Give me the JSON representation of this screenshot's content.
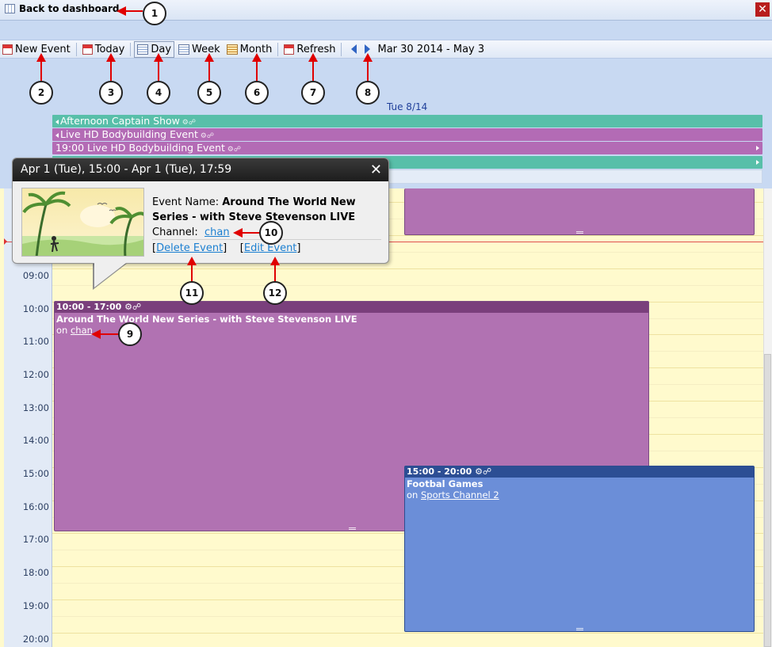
{
  "top": {
    "back_label": "Back to dashboard",
    "close_label": "✕"
  },
  "toolbar": {
    "new_event": "New Event",
    "today": "Today",
    "day": "Day",
    "week": "Week",
    "month": "Month",
    "refresh": "Refresh",
    "date_range": "Mar 30 2014 - May 3"
  },
  "day_header": "Tue 8/14",
  "all_day_events": [
    {
      "label": "Afternoon Captain Show",
      "color": "#58bfa9"
    },
    {
      "label": "Live HD Bodybuilding Event",
      "color": "#b36bb5"
    },
    {
      "label": "19:00 Live HD Bodybuilding Event",
      "color": "#b36bb5"
    }
  ],
  "hours": [
    "09:00",
    "10:00",
    "11:00",
    "12:00",
    "13:00",
    "14:00",
    "15:00",
    "16:00",
    "17:00",
    "18:00",
    "19:00",
    "20:00"
  ],
  "events": {
    "main": {
      "time": "10:00 - 17:00",
      "title": "Around The World New Series - with Steve Stevenson LIVE",
      "on": "on",
      "channel": "chan",
      "color": "#b172b2"
    },
    "blue": {
      "time": "15:00 - 20:00",
      "title": "Footbal Games",
      "on": "on",
      "channel": "Sports Channel 2",
      "color": "#6b8ed8"
    }
  },
  "popup": {
    "header": "Apr 1 (Tue), 15:00 - Apr 1 (Tue), 17:59",
    "close": "✕",
    "name_label": "Event Name: ",
    "name_value": "Around The World New Series - with Steve Stevenson LIVE",
    "channel_label": "Channel:",
    "channel_value": "chan",
    "delete_label": "Delete Event",
    "edit_label": "Edit Event"
  },
  "annotations": [
    "1",
    "2",
    "3",
    "4",
    "5",
    "6",
    "7",
    "8",
    "9",
    "10",
    "11",
    "12"
  ]
}
